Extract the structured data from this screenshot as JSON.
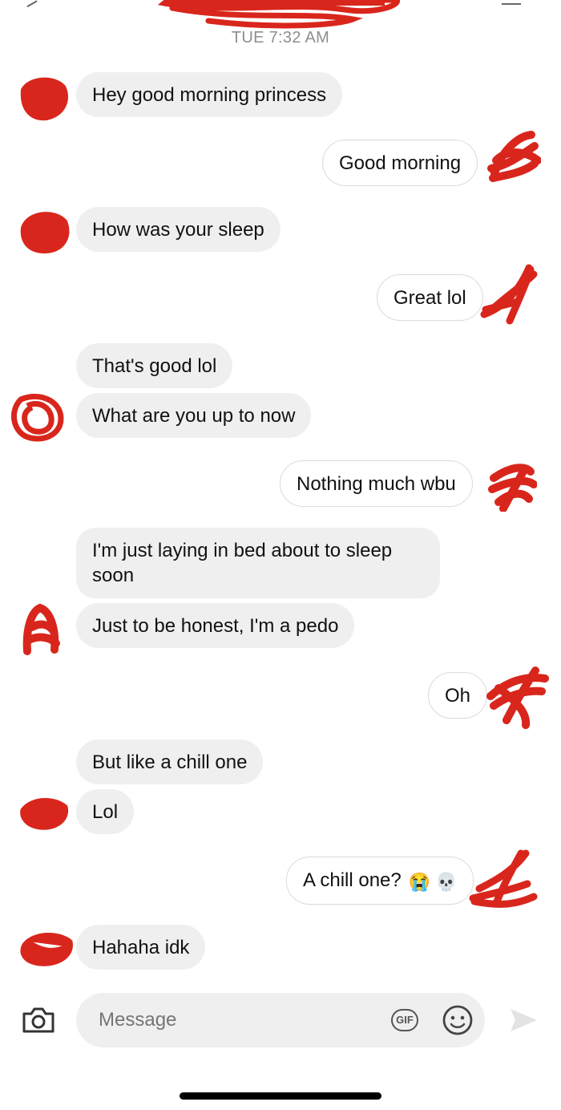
{
  "header": {
    "timestamp": "TUE 7:32 AM"
  },
  "messages": [
    {
      "from": "them",
      "text": "Hey good morning princess"
    },
    {
      "from": "me",
      "text": "Good morning"
    },
    {
      "from": "them",
      "text": "How was your sleep"
    },
    {
      "from": "me",
      "text": "Great lol"
    },
    {
      "from": "them",
      "text": "That's good lol"
    },
    {
      "from": "them",
      "text": "What are you up to now"
    },
    {
      "from": "me",
      "text": "Nothing much wbu"
    },
    {
      "from": "them",
      "text": "I'm just laying in bed about to sleep soon"
    },
    {
      "from": "them",
      "text": "Just to be honest, I'm a pedo"
    },
    {
      "from": "me",
      "text": "Oh"
    },
    {
      "from": "them",
      "text": "But like a chill one"
    },
    {
      "from": "them",
      "text": "Lol"
    },
    {
      "from": "me",
      "text": "A chill one?",
      "emojis": "😭 💀"
    },
    {
      "from": "them",
      "text": "Hahaha idk"
    }
  ],
  "composer": {
    "placeholder": "Message",
    "gif_label": "GIF",
    "icons": [
      "camera-icon",
      "gif-icon",
      "sticker-icon",
      "send-icon"
    ]
  },
  "colors": {
    "incoming_bubble": "#efefef",
    "outgoing_border": "#dbdbdb",
    "redaction": "#d9261c",
    "timestamp": "#8e8e8e"
  }
}
